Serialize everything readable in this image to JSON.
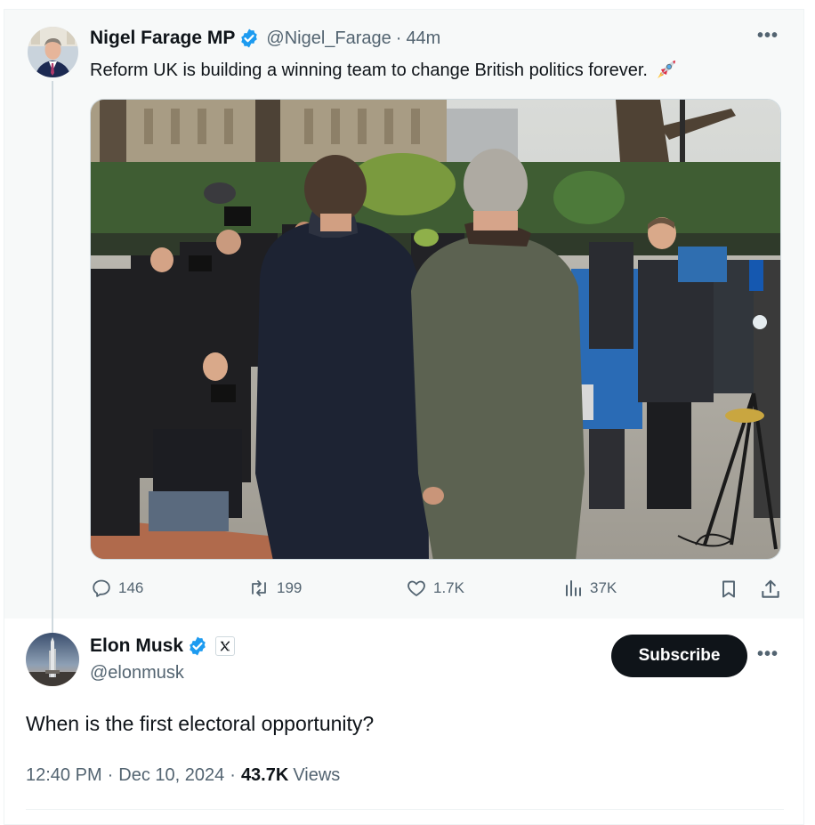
{
  "parent_tweet": {
    "author_name": "Nigel Farage MP",
    "handle": "@Nigel_Farage",
    "separator": "·",
    "time": "44m",
    "text": "Reform UK is building a winning team to change British politics forever.",
    "emoji_icon": "rocket-icon",
    "more": "•••",
    "actions": {
      "replies": "146",
      "reposts": "199",
      "likes": "1.7K",
      "views": "37K"
    }
  },
  "reply_tweet": {
    "author_name": "Elon Musk",
    "handle": "@elonmusk",
    "affiliation_icon": "x-logo-icon",
    "subscribe_label": "Subscribe",
    "more": "•••",
    "text": "When is the first electoral opportunity?",
    "time": "12:40 PM",
    "date": "Dec 10, 2024",
    "views_count": "43.7K",
    "views_label": "Views",
    "separator": "·"
  },
  "colors": {
    "verified_blue": "#1d9bf0",
    "text_primary": "#0f1419",
    "text_secondary": "#536471",
    "button_dark": "#0f1419",
    "parent_background": "#f7f9f9"
  }
}
